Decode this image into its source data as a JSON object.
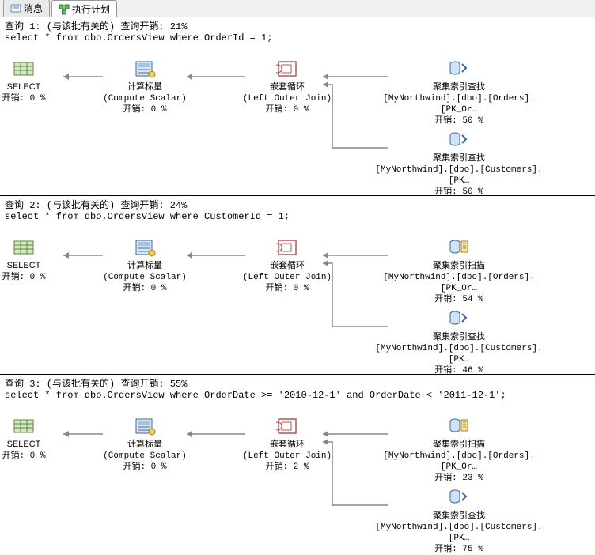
{
  "tabs": {
    "messages": "消息",
    "plan": "执行计划"
  },
  "queries": [
    {
      "title": "查询 1: (与该批有关的) 查询开销: 21%",
      "sql": "select * from dbo.OrdersView where OrderId = 1;",
      "nodes": {
        "select": {
          "name": "SELECT",
          "sub": "",
          "cost": "开销: 0 %"
        },
        "compute": {
          "name": "计算标量",
          "sub": "(Compute Scalar)",
          "cost": "开销: 0 %"
        },
        "loop": {
          "name": "嵌套循环",
          "sub": "(Left Outer Join)",
          "cost": "开销: 0 %"
        },
        "seek1": {
          "name": "聚集索引查找",
          "sub": "[MyNorthwind].[dbo].[Orders].[PK_Or…",
          "cost": "开销: 50 %"
        },
        "seek2": {
          "name": "聚集索引查找",
          "sub": "[MyNorthwind].[dbo].[Customers].[PK…",
          "cost": "开销: 50 %"
        }
      }
    },
    {
      "title": "查询 2: (与该批有关的) 查询开销: 24%",
      "sql": "select * from dbo.OrdersView where CustomerId = 1;",
      "nodes": {
        "select": {
          "name": "SELECT",
          "sub": "",
          "cost": "开销: 0 %"
        },
        "compute": {
          "name": "计算标量",
          "sub": "(Compute Scalar)",
          "cost": "开销: 0 %"
        },
        "loop": {
          "name": "嵌套循环",
          "sub": "(Left Outer Join)",
          "cost": "开销: 0 %"
        },
        "scan1": {
          "name": "聚集索引扫描",
          "sub": "[MyNorthwind].[dbo].[Orders].[PK_Or…",
          "cost": "开销: 54 %"
        },
        "seek2": {
          "name": "聚集索引查找",
          "sub": "[MyNorthwind].[dbo].[Customers].[PK…",
          "cost": "开销: 46 %"
        }
      }
    },
    {
      "title": "查询 3: (与该批有关的) 查询开销: 55%",
      "sql": "select * from dbo.OrdersView where OrderDate >= '2010-12-1' and OrderDate < '2011-12-1';",
      "nodes": {
        "select": {
          "name": "SELECT",
          "sub": "",
          "cost": "开销: 0 %"
        },
        "compute": {
          "name": "计算标量",
          "sub": "(Compute Scalar)",
          "cost": "开销: 0 %"
        },
        "loop": {
          "name": "嵌套循环",
          "sub": "(Left Outer Join)",
          "cost": "开销: 2 %"
        },
        "scan1": {
          "name": "聚集索引扫描",
          "sub": "[MyNorthwind].[dbo].[Orders].[PK_Or…",
          "cost": "开销: 23 %"
        },
        "seek2": {
          "name": "聚集索引查找",
          "sub": "[MyNorthwind].[dbo].[Customers].[PK…",
          "cost": "开销: 75 %"
        }
      }
    }
  ]
}
